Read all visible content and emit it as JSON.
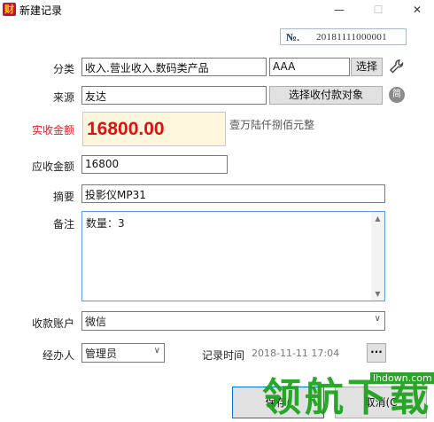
{
  "window": {
    "title": "新建记录",
    "app_icon_glyph": "财",
    "min_glyph": "—",
    "max_glyph": "☐",
    "close_glyph": "✕"
  },
  "record": {
    "no_label": "№.",
    "no_value": "20181111000001"
  },
  "category": {
    "label": "分类",
    "value": "收入.营业收入.数码类产品",
    "code": "AAA",
    "select_button": "选择",
    "tool_icon": "wrench-icon"
  },
  "source": {
    "label": "来源",
    "value": "友达",
    "select_button": "选择收付款对象",
    "circle_icon": "简"
  },
  "actual_amount": {
    "label": "实收金额",
    "value": "16800.00",
    "uppercase": "壹万陆仟捌佰元整"
  },
  "due_amount": {
    "label": "应收金额",
    "value": "16800"
  },
  "summary": {
    "label": "摘要",
    "value": "投影仪MP31"
  },
  "remarks": {
    "label": "备注",
    "value": "数量：3"
  },
  "account": {
    "label": "收款账户",
    "value": "微信"
  },
  "handler": {
    "label": "经办人",
    "value": "管理员"
  },
  "record_time": {
    "label": "记录时间",
    "value": "2018-11-11 17:04",
    "more_button": "···"
  },
  "footer": {
    "save_button": "保存(",
    "cancel_button": "取消(C"
  },
  "watermark": {
    "text": "领航下载",
    "url": "lhdown.com"
  },
  "colors": {
    "accent_red": "#e02020",
    "amount_bg": "#fdf6dc",
    "focus_blue": "#569de5",
    "watermark_green": "#1aa21a"
  }
}
